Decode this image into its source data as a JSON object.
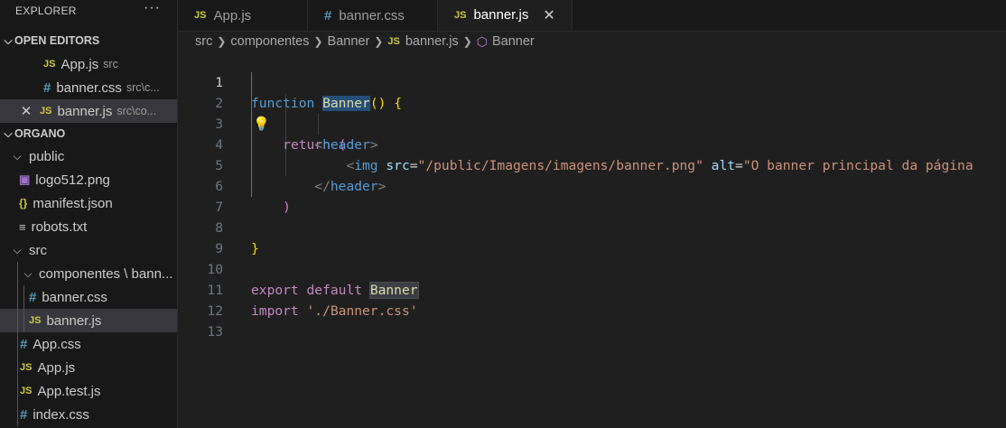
{
  "explorer": {
    "title": "EXPLORER",
    "more": "···",
    "open_editors": {
      "label": "OPEN EDITORS",
      "items": [
        {
          "icon": "JS",
          "name": "App.js",
          "hint": "src"
        },
        {
          "icon": "#",
          "name": "banner.css",
          "hint": "src\\c..."
        },
        {
          "icon": "JS",
          "name": "banner.js",
          "hint": "src\\co...",
          "close": "✕"
        }
      ]
    },
    "project": {
      "label": "ORGANO",
      "public": {
        "label": "public",
        "files": [
          {
            "icon": "▣",
            "name": "logo512.png"
          },
          {
            "icon": "{}",
            "name": "manifest.json"
          },
          {
            "icon": "≡",
            "name": "robots.txt"
          }
        ]
      },
      "src": {
        "label": "src",
        "componentes": {
          "label": "componentes \\ bann...",
          "files": [
            {
              "icon": "#",
              "name": "banner.css"
            },
            {
              "icon": "JS",
              "name": "banner.js"
            }
          ]
        },
        "files": [
          {
            "icon": "#",
            "name": "App.css"
          },
          {
            "icon": "JS",
            "name": "App.js"
          },
          {
            "icon": "JS",
            "name": "App.test.js"
          },
          {
            "icon": "#",
            "name": "index.css"
          }
        ]
      }
    }
  },
  "tabs": [
    {
      "icon": "JS",
      "label": "App.js"
    },
    {
      "icon": "#",
      "label": "banner.css"
    },
    {
      "icon": "JS",
      "label": "banner.js",
      "close": "✕"
    }
  ],
  "breadcrumb": {
    "parts": [
      "src",
      "componentes",
      "Banner"
    ],
    "file_icon": "JS",
    "file": "banner.js",
    "symbol_icon": "⬡",
    "symbol": "Banner",
    "sep": "❯"
  },
  "editor": {
    "line_numbers": [
      "1",
      "2",
      "3",
      "4",
      "5",
      "6",
      "7",
      "8",
      "9",
      "10",
      "11",
      "12",
      "13"
    ],
    "code": {
      "l1_kw": "function",
      "l1_name": "Banner",
      "l1_parens": "()",
      "l1_brace": "{",
      "l2_return": "return",
      "l2_paren": "(",
      "l3_open": "<",
      "l3_tag": "header",
      "l3_close": ">",
      "l4_open": "<",
      "l4_tag": "img",
      "l4_attr1": "src",
      "l4_eq1": "=",
      "l4_val1": "\"/public/Imagens/imagens/banner.png\"",
      "l4_attr2": "alt",
      "l4_eq2": "=",
      "l4_val2": "\"O banner principal da página",
      "l5_open": "</",
      "l5_tag": "header",
      "l5_close": ">",
      "l6_paren": ")",
      "l8_brace": "}",
      "l10_export": "export",
      "l10_default": "default",
      "l10_name": "Banner",
      "l11_import": "import",
      "l11_str": "'./Banner.css'"
    },
    "lightbulb": "💡"
  }
}
